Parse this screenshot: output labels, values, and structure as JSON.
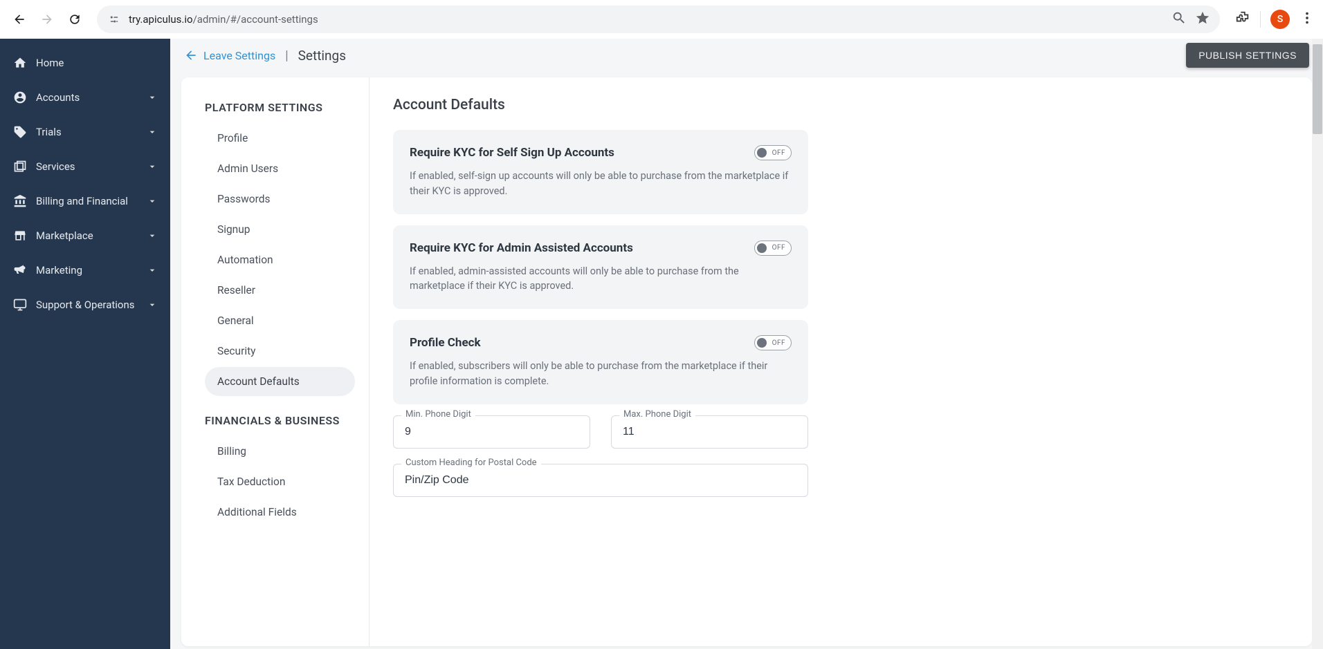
{
  "browser": {
    "url_prefix": "try.apiculus.io",
    "url_path": "/admin/#/account-settings",
    "avatar_letter": "S"
  },
  "sidebar": {
    "items": [
      {
        "label": "Home",
        "icon": "home",
        "expandable": false
      },
      {
        "label": "Accounts",
        "icon": "user-circle",
        "expandable": true
      },
      {
        "label": "Trials",
        "icon": "tag",
        "expandable": true
      },
      {
        "label": "Services",
        "icon": "layers",
        "expandable": true
      },
      {
        "label": "Billing and Financial",
        "icon": "bank",
        "expandable": true
      },
      {
        "label": "Marketplace",
        "icon": "store",
        "expandable": true
      },
      {
        "label": "Marketing",
        "icon": "megaphone",
        "expandable": true
      },
      {
        "label": "Support & Operations",
        "icon": "monitor",
        "expandable": true
      }
    ]
  },
  "topbar": {
    "back_label": "Leave Settings",
    "title": "Settings",
    "publish_label": "PUBLISH SETTINGS"
  },
  "subnav": {
    "section1_heading": "PLATFORM SETTINGS",
    "section1_items": [
      {
        "label": "Profile",
        "active": false
      },
      {
        "label": "Admin Users",
        "active": false
      },
      {
        "label": "Passwords",
        "active": false
      },
      {
        "label": "Signup",
        "active": false
      },
      {
        "label": "Automation",
        "active": false
      },
      {
        "label": "Reseller",
        "active": false
      },
      {
        "label": "General",
        "active": false
      },
      {
        "label": "Security",
        "active": false
      },
      {
        "label": "Account Defaults",
        "active": true
      }
    ],
    "section2_heading": "FINANCIALS & BUSINESS",
    "section2_items": [
      {
        "label": "Billing",
        "active": false
      },
      {
        "label": "Tax Deduction",
        "active": false
      },
      {
        "label": "Additional Fields",
        "active": false
      }
    ]
  },
  "main": {
    "title": "Account Defaults",
    "cards": [
      {
        "title": "Require KYC for Self Sign Up Accounts",
        "desc": "If enabled, self-sign up accounts will only be able to purchase from the marketplace if their KYC is approved.",
        "toggle_state": "OFF"
      },
      {
        "title": "Require KYC for Admin Assisted Accounts",
        "desc": "If enabled, admin-assisted accounts will only be able to purchase from the marketplace if their KYC is approved.",
        "toggle_state": "OFF"
      },
      {
        "title": "Profile Check",
        "desc": "If enabled, subscribers will only be able to purchase from the marketplace if their profile information is complete.",
        "toggle_state": "OFF"
      }
    ],
    "fields": {
      "min_phone_label": "Min. Phone Digit",
      "min_phone_value": "9",
      "max_phone_label": "Max. Phone Digit",
      "max_phone_value": "11",
      "postal_label": "Custom Heading for Postal Code",
      "postal_value": "Pin/Zip Code"
    }
  }
}
